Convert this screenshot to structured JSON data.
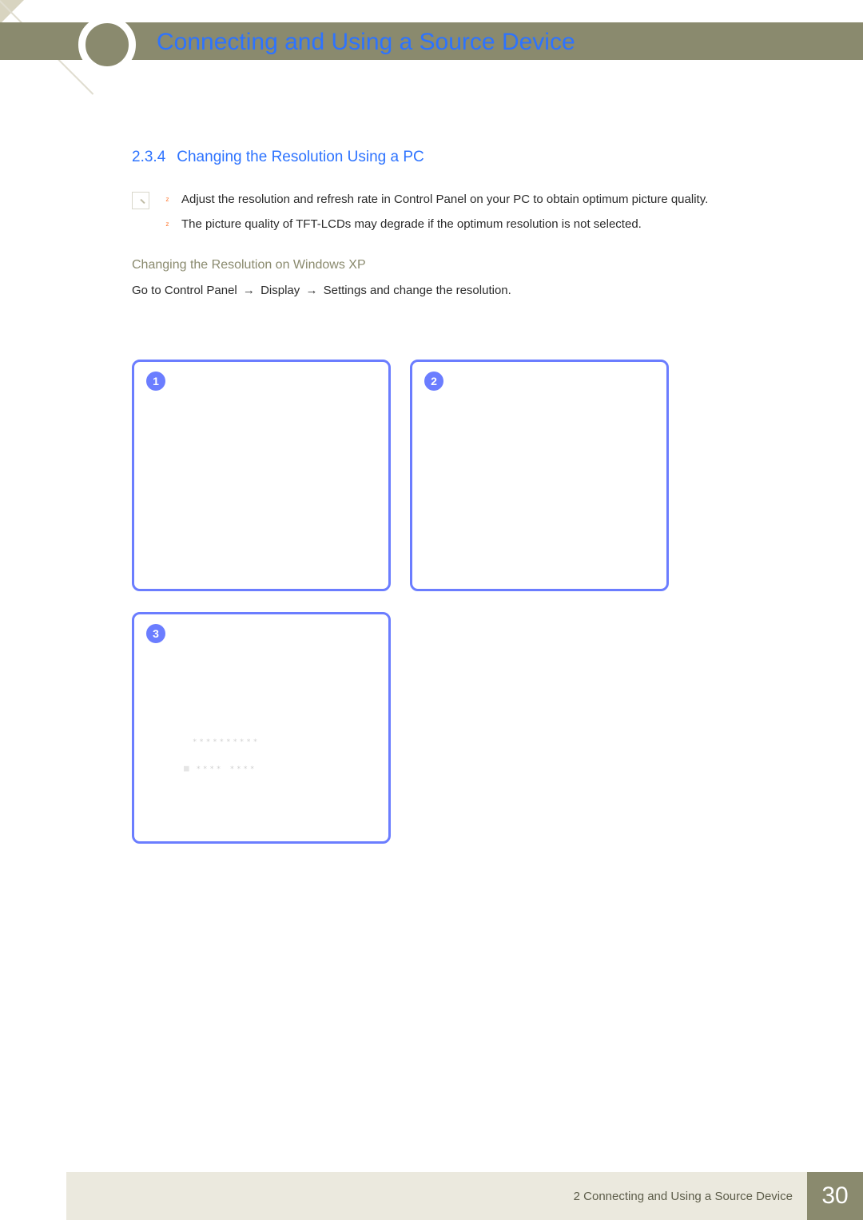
{
  "chapter_title": "Connecting and Using a Source Device",
  "section": {
    "number": "2.3.4",
    "title": "Changing the Resolution Using a PC"
  },
  "notes": [
    "Adjust the resolution and refresh rate in Control Panel on your PC to obtain optimum picture quality.",
    "The picture quality of TFT-LCDs may degrade if the optimum resolution is not selected."
  ],
  "sub_heading": "Changing the Resolution on Windows XP",
  "instruction": {
    "prefix": "Go to ",
    "path": [
      "Control Panel",
      "Display",
      "Settings"
    ],
    "suffix": " and change the resolution."
  },
  "steps": [
    "1",
    "2",
    "3"
  ],
  "placeholders": {
    "line1": "**********",
    "line2": "****   ****"
  },
  "footer": {
    "chapter_ref": "2 Connecting and Using a Source Device",
    "page_number": "30"
  }
}
